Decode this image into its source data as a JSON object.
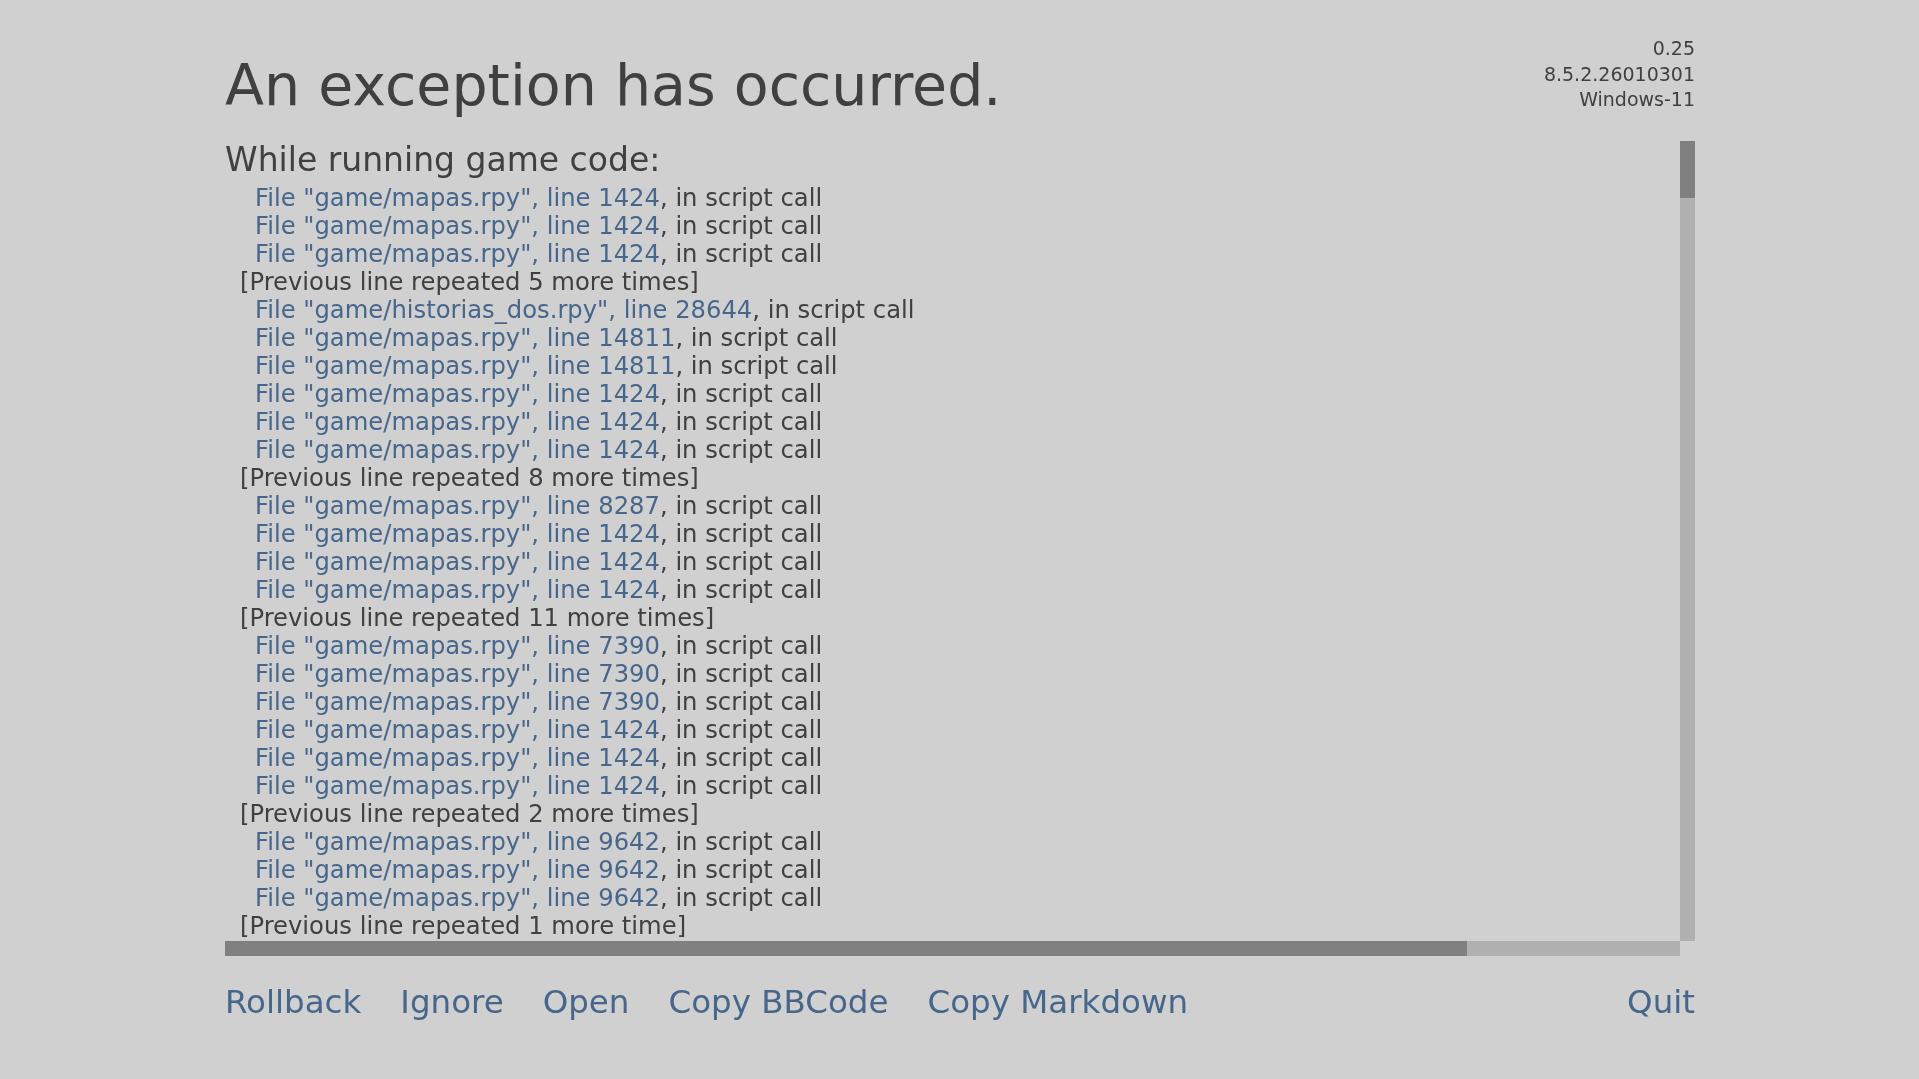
{
  "title": "An exception has occurred.",
  "version_info": [
    "0.25",
    "8.5.2.26010301",
    "Windows-11"
  ],
  "traceback": {
    "heading": "While running game code:",
    "lines": [
      {
        "kind": "frame",
        "location": "File \"game/mapas.rpy\", line 1424",
        "detail": ", in script call"
      },
      {
        "kind": "frame",
        "location": "File \"game/mapas.rpy\", line 1424",
        "detail": ", in script call"
      },
      {
        "kind": "frame",
        "location": "File \"game/mapas.rpy\", line 1424",
        "detail": ", in script call"
      },
      {
        "kind": "repeat",
        "text": "[Previous line repeated 5 more times]"
      },
      {
        "kind": "frame",
        "location": "File \"game/historias_dos.rpy\", line 28644",
        "detail": ", in script call"
      },
      {
        "kind": "frame",
        "location": "File \"game/mapas.rpy\", line 14811",
        "detail": ", in script call"
      },
      {
        "kind": "frame",
        "location": "File \"game/mapas.rpy\", line 14811",
        "detail": ", in script call"
      },
      {
        "kind": "frame",
        "location": "File \"game/mapas.rpy\", line 1424",
        "detail": ", in script call"
      },
      {
        "kind": "frame",
        "location": "File \"game/mapas.rpy\", line 1424",
        "detail": ", in script call"
      },
      {
        "kind": "frame",
        "location": "File \"game/mapas.rpy\", line 1424",
        "detail": ", in script call"
      },
      {
        "kind": "repeat",
        "text": "[Previous line repeated 8 more times]"
      },
      {
        "kind": "frame",
        "location": "File \"game/mapas.rpy\", line 8287",
        "detail": ", in script call"
      },
      {
        "kind": "frame",
        "location": "File \"game/mapas.rpy\", line 1424",
        "detail": ", in script call"
      },
      {
        "kind": "frame",
        "location": "File \"game/mapas.rpy\", line 1424",
        "detail": ", in script call"
      },
      {
        "kind": "frame",
        "location": "File \"game/mapas.rpy\", line 1424",
        "detail": ", in script call"
      },
      {
        "kind": "repeat",
        "text": "[Previous line repeated 11 more times]"
      },
      {
        "kind": "frame",
        "location": "File \"game/mapas.rpy\", line 7390",
        "detail": ", in script call"
      },
      {
        "kind": "frame",
        "location": "File \"game/mapas.rpy\", line 7390",
        "detail": ", in script call"
      },
      {
        "kind": "frame",
        "location": "File \"game/mapas.rpy\", line 7390",
        "detail": ", in script call"
      },
      {
        "kind": "frame",
        "location": "File \"game/mapas.rpy\", line 1424",
        "detail": ", in script call"
      },
      {
        "kind": "frame",
        "location": "File \"game/mapas.rpy\", line 1424",
        "detail": ", in script call"
      },
      {
        "kind": "frame",
        "location": "File \"game/mapas.rpy\", line 1424",
        "detail": ", in script call"
      },
      {
        "kind": "repeat",
        "text": "[Previous line repeated 2 more times]"
      },
      {
        "kind": "frame",
        "location": "File \"game/mapas.rpy\", line 9642",
        "detail": ", in script call"
      },
      {
        "kind": "frame",
        "location": "File \"game/mapas.rpy\", line 9642",
        "detail": ", in script call"
      },
      {
        "kind": "frame",
        "location": "File \"game/mapas.rpy\", line 9642",
        "detail": ", in script call"
      },
      {
        "kind": "repeat",
        "text": "[Previous line repeated 1 more time]"
      }
    ]
  },
  "buttons": [
    "Rollback",
    "Ignore",
    "Open",
    "Copy BBCode",
    "Copy Markdown"
  ],
  "quit_button": "Quit"
}
